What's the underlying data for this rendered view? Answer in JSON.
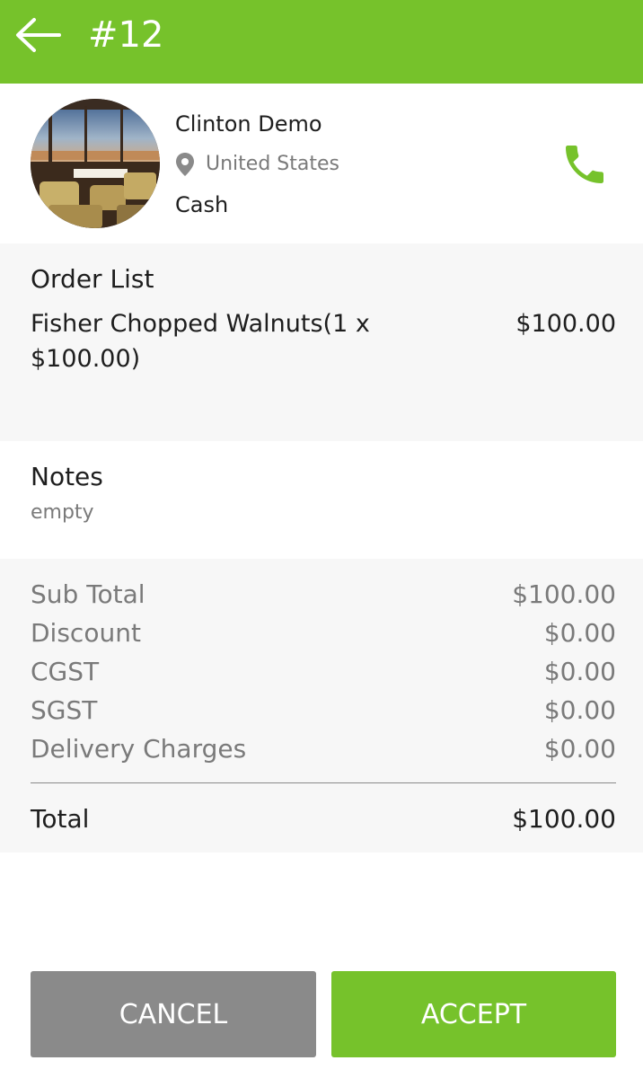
{
  "header": {
    "title": "#12",
    "back_icon": "arrow-left-icon",
    "background_color": "#76c22b"
  },
  "customer": {
    "name": "Clinton Demo",
    "location": "United States",
    "payment_method": "Cash",
    "location_icon": "map-pin-icon",
    "call_icon": "phone-icon"
  },
  "order_list": {
    "title": "Order List",
    "items": [
      {
        "description": "Fisher Chopped Walnuts(1 x $100.00)",
        "price": "$100.00"
      }
    ]
  },
  "notes": {
    "title": "Notes",
    "text": "empty"
  },
  "summary": {
    "rows": [
      {
        "label": "Sub Total",
        "value": "$100.00"
      },
      {
        "label": "Discount",
        "value": "$0.00"
      },
      {
        "label": "CGST",
        "value": "$0.00"
      },
      {
        "label": "SGST",
        "value": "$0.00"
      },
      {
        "label": "Delivery Charges",
        "value": "$0.00"
      }
    ],
    "total_label": "Total",
    "total_value": "$100.00"
  },
  "actions": {
    "cancel_label": "CANCEL",
    "accept_label": "ACCEPT",
    "cancel_color": "#8a8a8a",
    "accept_color": "#76c22b"
  }
}
